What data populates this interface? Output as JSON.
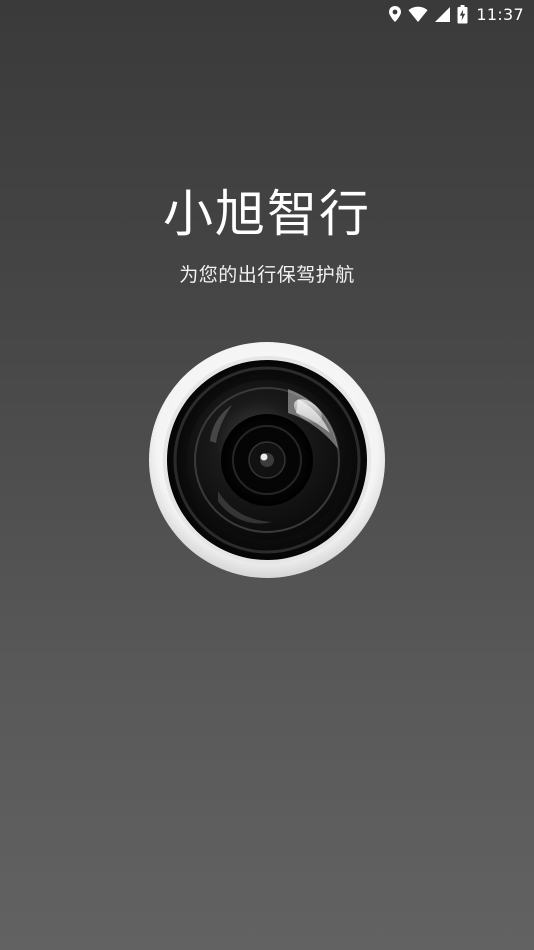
{
  "status_bar": {
    "time": "11:37",
    "icons": [
      "location-icon",
      "wifi-icon",
      "signal-icon",
      "battery-charging-icon"
    ],
    "icon_color": "#ffffff"
  },
  "splash": {
    "title": "小旭智行",
    "subtitle": "为您的出行保驾护航",
    "logo": "camera-lens-icon"
  },
  "colors": {
    "background_top": "#3a3a3a",
    "background_bottom": "#626262",
    "text": "#ffffff",
    "lens_ring": "#f2f2f2"
  }
}
